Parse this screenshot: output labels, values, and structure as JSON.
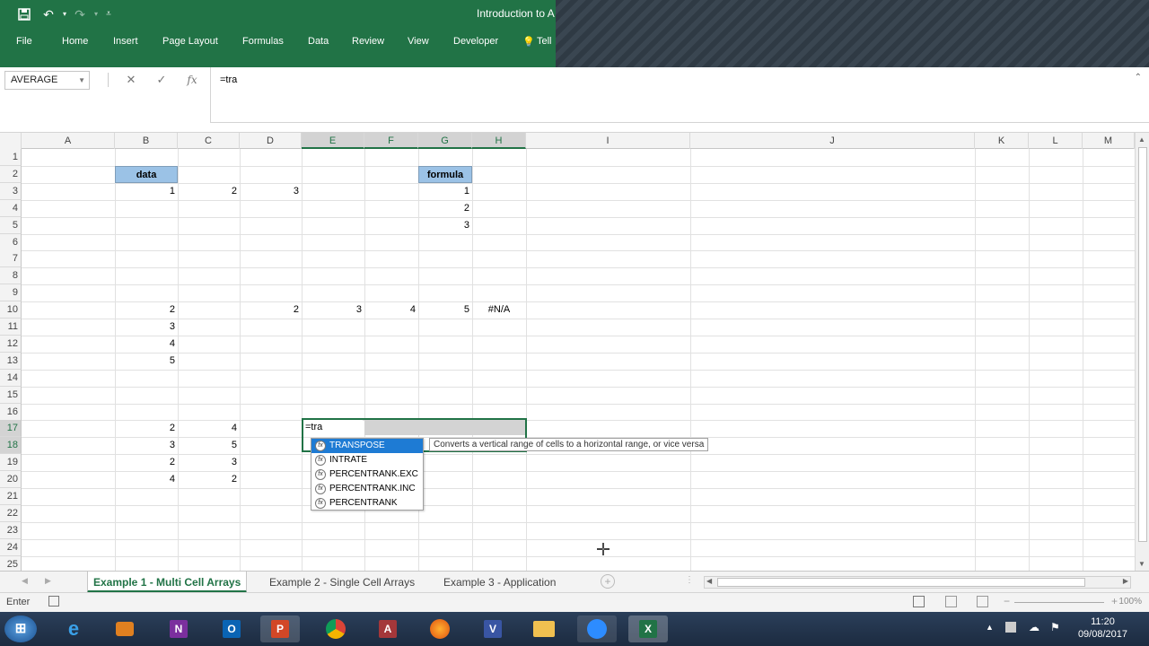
{
  "window": {
    "title": "Introduction to A",
    "quick_access": [
      "save-icon",
      "undo-icon",
      "redo-icon",
      "customize-icon"
    ]
  },
  "ribbon": {
    "tabs": [
      "File",
      "Home",
      "Insert",
      "Page Layout",
      "Formulas",
      "Data",
      "Review",
      "View",
      "Developer",
      "Tell"
    ]
  },
  "formula_bar": {
    "name_box": "AVERAGE",
    "cancel_symbol": "✕",
    "enter_symbol": "✓",
    "fx_symbol": "fx",
    "content": "=tra"
  },
  "columns": [
    "A",
    "B",
    "C",
    "D",
    "E",
    "F",
    "G",
    "H",
    "I",
    "J",
    "K",
    "L",
    "M"
  ],
  "rows": [
    "1",
    "2",
    "3",
    "4",
    "5",
    "6",
    "7",
    "8",
    "9",
    "10",
    "11",
    "12",
    "13",
    "14",
    "15",
    "16",
    "17",
    "18",
    "19",
    "20",
    "21",
    "22",
    "23",
    "24",
    "25"
  ],
  "cells": {
    "B2": "data",
    "G2": "formula",
    "B3": "1",
    "C3": "2",
    "D3": "3",
    "G3": "1",
    "G4": "2",
    "G5": "3",
    "B10": "2",
    "D10": "2",
    "E10": "3",
    "F10": "4",
    "G10": "5",
    "H10": "#N/A",
    "B11": "3",
    "B12": "4",
    "B13": "5",
    "B17": "2",
    "C17": "4",
    "B18": "3",
    "C18": "5",
    "B19": "2",
    "C19": "3",
    "B20": "4",
    "C20": "2",
    "E17": "=tra"
  },
  "autocomplete": {
    "items": [
      "TRANSPOSE",
      "INTRATE",
      "PERCENTRANK.EXC",
      "PERCENTRANK.INC",
      "PERCENTRANK"
    ],
    "selected": "TRANSPOSE",
    "tooltip": "Converts a vertical range of cells to a horizontal range, or vice versa"
  },
  "sheets": {
    "tabs": [
      "Example 1 - Multi Cell Arrays",
      "Example 2 - Single Cell Arrays",
      "Example 3 - Application"
    ],
    "active": "Example 1 - Multi Cell Arrays"
  },
  "status": {
    "mode": "Enter",
    "zoom": "100%"
  },
  "taskbar": {
    "apps": [
      "start-orb",
      "internet-explorer",
      "media-player",
      "onenote",
      "outlook",
      "powerpoint",
      "chrome",
      "access",
      "firefox",
      "visio",
      "file-explorer",
      "zoom",
      "excel"
    ],
    "time": "11:20",
    "date": "09/08/2017"
  },
  "colors": {
    "excel_green": "#217346",
    "header_fill": "#9bc2e6",
    "selection_blue": "#1e7bd4"
  }
}
